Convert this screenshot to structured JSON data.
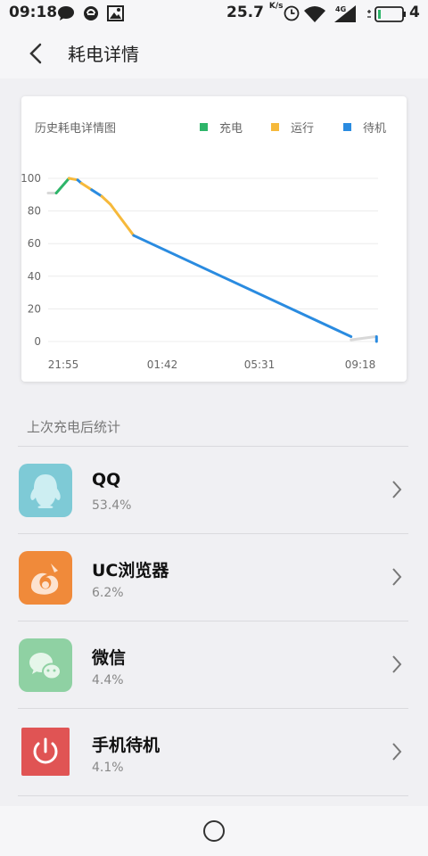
{
  "status": {
    "time": "09:18",
    "speed": "25.7",
    "speed_unit": "K/s",
    "network": "4G",
    "battery": "4"
  },
  "header": {
    "title": "耗电详情"
  },
  "chart": {
    "title": "历史耗电详情图",
    "legend": [
      {
        "label": "充电",
        "color": "#2eb56a"
      },
      {
        "label": "运行",
        "color": "#f6b93b"
      },
      {
        "label": "待机",
        "color": "#2a8be0"
      }
    ],
    "idle_color": "#d8d8d8"
  },
  "chart_data": {
    "type": "line",
    "title": "历史耗电详情图",
    "xlabel": "",
    "ylabel": "",
    "x_ticks": [
      "21:55",
      "01:42",
      "05:31",
      "09:18"
    ],
    "y_ticks": [
      0,
      20,
      40,
      60,
      80,
      100
    ],
    "ylim": [
      0,
      100
    ],
    "x_range_hours": [
      0,
      11.383
    ],
    "grid": true,
    "legend_position": "top-right",
    "segments": [
      {
        "state": "idle",
        "points": [
          [
            0.0,
            91
          ],
          [
            0.28,
            91
          ]
        ]
      },
      {
        "state": "charge",
        "points": [
          [
            0.28,
            91
          ],
          [
            0.72,
            100
          ]
        ]
      },
      {
        "state": "run",
        "points": [
          [
            0.72,
            100
          ],
          [
            1.02,
            99
          ]
        ]
      },
      {
        "state": "standby",
        "points": [
          [
            1.02,
            99
          ],
          [
            1.15,
            97
          ]
        ]
      },
      {
        "state": "run",
        "points": [
          [
            1.15,
            97
          ],
          [
            1.5,
            93
          ]
        ]
      },
      {
        "state": "standby",
        "points": [
          [
            1.5,
            93
          ],
          [
            1.85,
            89
          ]
        ]
      },
      {
        "state": "run",
        "points": [
          [
            1.85,
            89
          ],
          [
            2.15,
            84
          ]
        ]
      },
      {
        "state": "run",
        "points": [
          [
            2.15,
            84
          ],
          [
            2.95,
            65
          ]
        ]
      },
      {
        "state": "standby",
        "points": [
          [
            2.95,
            65
          ],
          [
            10.45,
            3
          ]
        ]
      },
      {
        "state": "idle",
        "points": [
          [
            10.45,
            1
          ],
          [
            11.3,
            3
          ]
        ]
      },
      {
        "state": "standby",
        "points": [
          [
            11.33,
            3
          ],
          [
            11.33,
            0
          ]
        ]
      }
    ]
  },
  "section": {
    "title": "上次充电后统计"
  },
  "apps": [
    {
      "name": "QQ",
      "percent": "53.4%"
    },
    {
      "name": "UC浏览器",
      "percent": "6.2%"
    },
    {
      "name": "微信",
      "percent": "4.4%"
    },
    {
      "name": "手机待机",
      "percent": "4.1%"
    }
  ]
}
